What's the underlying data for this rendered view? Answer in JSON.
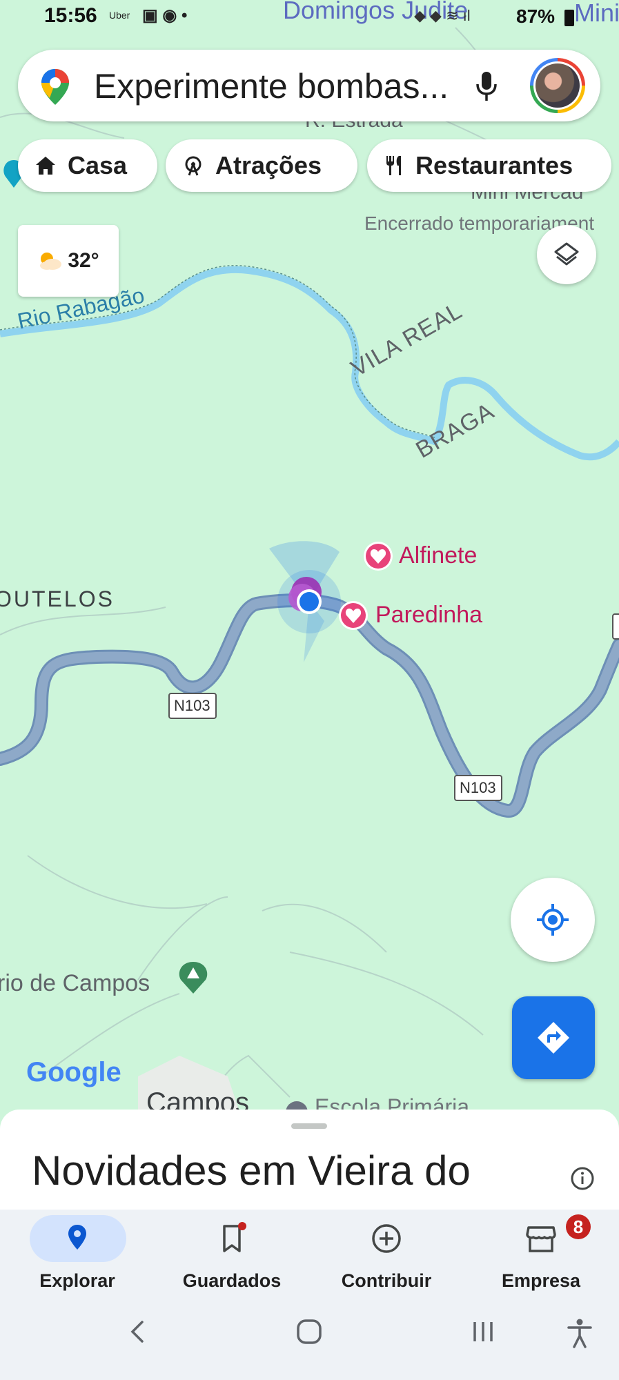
{
  "status_bar": {
    "time": "15:56",
    "app_icons": "Uber",
    "battery": "87%"
  },
  "search": {
    "text": "Experimente bombas..."
  },
  "chips": [
    {
      "label": "Casa",
      "icon": "home-icon"
    },
    {
      "label": "Atrações",
      "icon": "ferris-wheel-icon"
    },
    {
      "label": "Restaurantes",
      "icon": "fork-knife-icon"
    }
  ],
  "weather": {
    "temp": "32°",
    "icon": "partly-cloudy-icon"
  },
  "map": {
    "labels": {
      "domingos": "Domingos Judite",
      "minimerc_top": "Minim",
      "estrada": "R. Estrada",
      "mini_mercado": "Mini Mercad",
      "encerrado": "Encerrado temporariament",
      "rio": "Rio Rabagão",
      "vila_real": "VILA REAL",
      "braga": "BRAGA",
      "outelos": "OUTELOS",
      "alfinete": "Alfinete",
      "paredinha": "Paredinha",
      "road1": "N103",
      "road2": "N103",
      "rio_campos": "rio de Campos",
      "campos": "Campos",
      "escola": "Escola Primária",
      "google": "Google"
    },
    "colors": {
      "land": "#cdf5da",
      "river": "#8fd3ef",
      "road": "#8ea9c8",
      "saved_pin": "#e8437a",
      "location_dot": "#1a73e8"
    }
  },
  "sheet": {
    "title": "Novidades em Vieira do"
  },
  "bottom_nav": {
    "tabs": [
      {
        "label": "Explorar",
        "icon": "explore-pin-icon",
        "active": true
      },
      {
        "label": "Guardados",
        "icon": "bookmark-icon",
        "active": false
      },
      {
        "label": "Contribuir",
        "icon": "add-circle-icon",
        "active": false
      },
      {
        "label": "Empresa",
        "icon": "store-icon",
        "active": false
      }
    ],
    "empresa_badge": "8"
  }
}
